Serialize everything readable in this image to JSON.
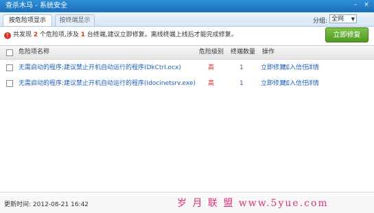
{
  "window": {
    "title": "查杀木马 - 系统安全",
    "minimize": "–",
    "close": "×"
  },
  "tabs": [
    {
      "label": "按危险项显示",
      "active": true
    },
    {
      "label": "按终端显示",
      "active": false
    }
  ],
  "group": {
    "label": "分组:",
    "selected": "全网",
    "arrow": "▼"
  },
  "summary": {
    "icon": "!",
    "part1": "共发现",
    "danger_count": "2",
    "part2": "个危险项,涉及",
    "terminal_count": "1",
    "part3": "台终端,建议立即修复。离线终端上线后才能完成修复。"
  },
  "fix_button": "立即修复",
  "table": {
    "headers": {
      "name": "危险项名称",
      "level": "危险级别",
      "terminals": "终端数量",
      "action": "操作"
    },
    "rows": [
      {
        "name": "无需启动的程序:建议禁止开机自动运行的程序(DkCtrl.ocx)",
        "level": "高",
        "terminals": "1",
        "actions": [
          "立即修复",
          "加入信任",
          "详情"
        ]
      },
      {
        "name": "无需启动的程序:建议禁止开机自动运行的程序(Idocinetsrv.exe)",
        "level": "高",
        "terminals": "1",
        "actions": [
          "立即修复",
          "加入信任",
          "详情"
        ]
      }
    ]
  },
  "footer": {
    "update_label": "更新时间:",
    "update_time": "2012-08-21 16:42"
  },
  "watermark": "岁 月 联 盟 www.5yue.com",
  "colors": {
    "titlebar": "#1a6fb8",
    "danger": "#e02020",
    "link": "#1b5fb5",
    "fix_button": "#4f9a22",
    "watermark": "#d8327a"
  }
}
